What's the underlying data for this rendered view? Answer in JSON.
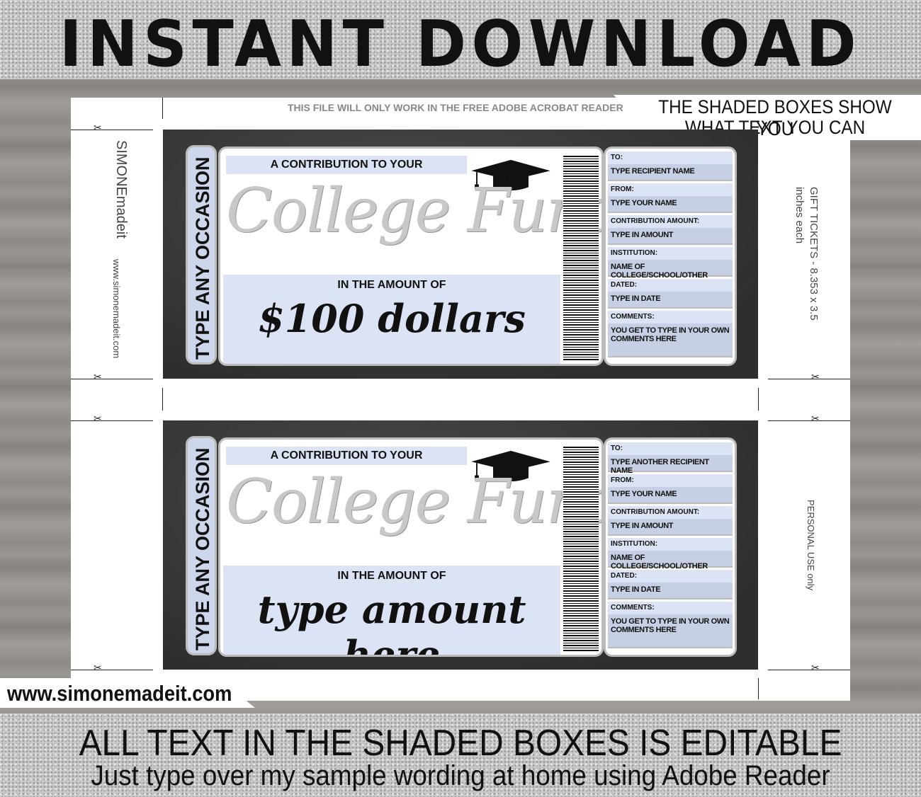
{
  "header": {
    "title": "INSTANT DOWNLOAD"
  },
  "notice": "THIS FILE WILL ONLY WORK IN THE FREE ADOBE ACROBAT READER",
  "callout": {
    "line1": "THE SHADED BOXES SHOW YOU",
    "line2": "WHAT TEXT YOU CAN CHANGE"
  },
  "brand": {
    "logo": "SIMONEmadeit",
    "url": "www.simonemadeit.com"
  },
  "side_right": {
    "ticket1": "GIFT TICKETS - 8.353 x 3.5 inches each",
    "ticket2": "PERSONAL USE only"
  },
  "footer": {
    "line1": "ALL TEXT IN THE SHADED BOXES IS EDITABLE",
    "line2": "Just type over my sample wording at home using Adobe Reader",
    "site": "www.simonemadeit.com"
  },
  "tickets": [
    {
      "occasion": "TYPE ANY OCCASION",
      "contribution": "A CONTRIBUTION TO YOUR",
      "title": "College Fund",
      "amount_label": "IN THE AMOUNT OF",
      "amount": "$100 dollars",
      "fields": [
        {
          "label": "TO:",
          "value": "TYPE RECIPIENT NAME"
        },
        {
          "label": "FROM:",
          "value": "TYPE YOUR NAME"
        },
        {
          "label": "CONTRIBUTION AMOUNT:",
          "value": "TYPE IN AMOUNT"
        },
        {
          "label": "INSTITUTION:",
          "value": "NAME OF COLLEGE/SCHOOL/OTHER"
        },
        {
          "label": "DATED:",
          "value": "TYPE IN DATE"
        },
        {
          "label": "COMMENTS:",
          "value": "YOU GET TO TYPE IN YOUR OWN COMMENTS HERE"
        }
      ]
    },
    {
      "occasion": "TYPE ANY OCCASION",
      "contribution": "A CONTRIBUTION TO YOUR",
      "title": "College Fund",
      "amount_label": "IN THE AMOUNT OF",
      "amount": "type amount here",
      "fields": [
        {
          "label": "TO:",
          "value": "TYPE ANOTHER RECIPIENT NAME"
        },
        {
          "label": "FROM:",
          "value": "TYPE YOUR NAME"
        },
        {
          "label": "CONTRIBUTION AMOUNT:",
          "value": "TYPE IN AMOUNT"
        },
        {
          "label": "INSTITUTION:",
          "value": "NAME OF COLLEGE/SCHOOL/OTHER"
        },
        {
          "label": "DATED:",
          "value": "TYPE IN DATE"
        },
        {
          "label": "COMMENTS:",
          "value": "YOU GET TO TYPE IN YOUR OWN COMMENTS HERE"
        }
      ]
    }
  ]
}
